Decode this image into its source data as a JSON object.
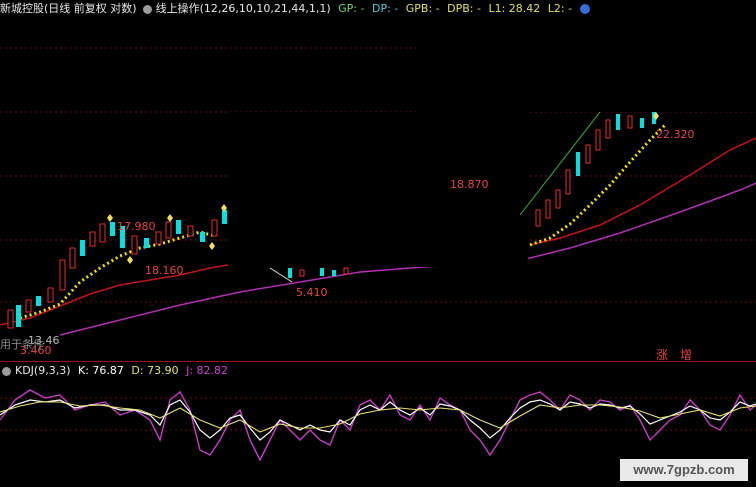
{
  "header": {
    "title": "新城控股(日线 前复权 对数)",
    "indicator": "线上操作(12,26,10,10,21,44,1,1)",
    "gp": "GP: -",
    "dp": "DP: -",
    "gpb": "GPB: -",
    "dpb": "DPB: -",
    "l1": "L1: 28.42",
    "l2": "L2: -"
  },
  "price_labels": {
    "p1": "17.980",
    "p2": "18.160",
    "p3": "5.410",
    "p4": "18.870",
    "p5": "22.320",
    "p6": "13.46",
    "p7": "3.460",
    "p8": "用于条件",
    "zhang": "涨",
    "zeng": "增"
  },
  "sub": {
    "name": "KDJ(9,3,3)",
    "k": "K: 76.87",
    "d": "D: 73.90",
    "j": "J: 82.82"
  },
  "watermark": "www.7gpzb.com",
  "colors": {
    "k": "#ffffff",
    "d": "#e8e070",
    "j": "#cc44cc",
    "red": "#d22",
    "purple": "#c040c0"
  }
}
